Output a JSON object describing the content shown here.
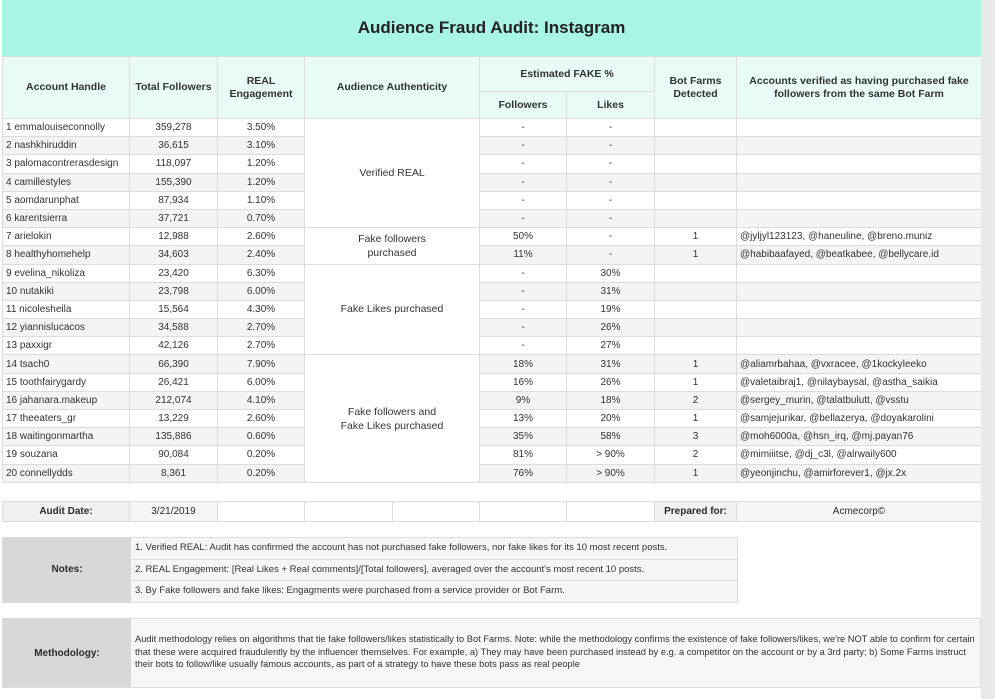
{
  "title": "Audience Fraud Audit: Instagram",
  "headers": {
    "account_handle": "Account Handle",
    "total_followers": "Total Followers",
    "real_engagement": "REAL Engagement",
    "audience_authenticity": "Audience Authenticity",
    "estimated_fake": "Estimated FAKE %",
    "fake_followers": "Followers",
    "fake_likes": "Likes",
    "bot_farms": "Bot Farms Detected",
    "same_farm_accounts": "Accounts verified as having purchased fake followers from the same Bot Farm"
  },
  "groups": {
    "verified_real": "Verified REAL",
    "fake_followers": "Fake followers purchased",
    "fake_likes": "Fake Likes purchased",
    "fake_both": "Fake followers and Fake Likes purchased"
  },
  "rows": [
    {
      "handle": "1 emmalouiseconnolly",
      "followers": "359,278",
      "engagement": "3.50%",
      "fake_followers": "-",
      "fake_likes": "-",
      "bot_farms": "",
      "accounts": ""
    },
    {
      "handle": "2 nashkhiruddin",
      "followers": "36,615",
      "engagement": "3.10%",
      "fake_followers": "-",
      "fake_likes": "-",
      "bot_farms": "",
      "accounts": ""
    },
    {
      "handle": "3 palomacontrerasdesign",
      "followers": "118,097",
      "engagement": "1.20%",
      "fake_followers": "-",
      "fake_likes": "-",
      "bot_farms": "",
      "accounts": ""
    },
    {
      "handle": "4 camillestyles",
      "followers": "155,390",
      "engagement": "1.20%",
      "fake_followers": "-",
      "fake_likes": "-",
      "bot_farms": "",
      "accounts": ""
    },
    {
      "handle": "5 aomdarunphat",
      "followers": "87,934",
      "engagement": "1.10%",
      "fake_followers": "-",
      "fake_likes": "-",
      "bot_farms": "",
      "accounts": ""
    },
    {
      "handle": "6 karentsierra",
      "followers": "37,721",
      "engagement": "0.70%",
      "fake_followers": "-",
      "fake_likes": "-",
      "bot_farms": "",
      "accounts": ""
    },
    {
      "handle": "7 arielokin",
      "followers": "12,988",
      "engagement": "2.60%",
      "fake_followers": "50%",
      "fake_likes": "-",
      "bot_farms": "1",
      "accounts": "@jyljyl123123, @haneuline, @breno.muniz"
    },
    {
      "handle": "8 healthyhomehelp",
      "followers": "34,603",
      "engagement": "2.40%",
      "fake_followers": "11%",
      "fake_likes": "-",
      "bot_farms": "1",
      "accounts": "@habibaafayed, @beatkabee, @bellycare.id"
    },
    {
      "handle": "9 evelina_nikoliza",
      "followers": "23,420",
      "engagement": "6.30%",
      "fake_followers": "-",
      "fake_likes": "30%",
      "bot_farms": "",
      "accounts": ""
    },
    {
      "handle": "10 nutakiki",
      "followers": "23,798",
      "engagement": "6.00%",
      "fake_followers": "-",
      "fake_likes": "31%",
      "bot_farms": "",
      "accounts": ""
    },
    {
      "handle": "11 nicolesheila",
      "followers": "15,564",
      "engagement": "4.30%",
      "fake_followers": "-",
      "fake_likes": "19%",
      "bot_farms": "",
      "accounts": ""
    },
    {
      "handle": "12 yiannislucacos",
      "followers": "34,588",
      "engagement": "2.70%",
      "fake_followers": "-",
      "fake_likes": "26%",
      "bot_farms": "",
      "accounts": ""
    },
    {
      "handle": "13 paxxigr",
      "followers": "42,126",
      "engagement": "2.70%",
      "fake_followers": "-",
      "fake_likes": "27%",
      "bot_farms": "",
      "accounts": ""
    },
    {
      "handle": "14 tsach0",
      "followers": "66,390",
      "engagement": "7.90%",
      "fake_followers": "18%",
      "fake_likes": "31%",
      "bot_farms": "1",
      "accounts": "@aliamrbahaa, @vxracee, @1kockyleeko"
    },
    {
      "handle": "15 toothfairygardy",
      "followers": "26,421",
      "engagement": "6.00%",
      "fake_followers": "16%",
      "fake_likes": "26%",
      "bot_farms": "1",
      "accounts": "@valetaibraj1, @nilaybaysal, @astha_saikia"
    },
    {
      "handle": "16 jahanara.makeup",
      "followers": "212,074",
      "engagement": "4.10%",
      "fake_followers": "9%",
      "fake_likes": "18%",
      "bot_farms": "2",
      "accounts": "@sergey_murin, @talatbulutt, @vsstu"
    },
    {
      "handle": "17 theeaters_gr",
      "followers": "13,229",
      "engagement": "2.60%",
      "fake_followers": "13%",
      "fake_likes": "20%",
      "bot_farms": "1",
      "accounts": "@samjejurikar, @bellazerya, @doyakarolini"
    },
    {
      "handle": "18 waitingonmartha",
      "followers": "135,886",
      "engagement": "0.60%",
      "fake_followers": "35%",
      "fake_likes": "58%",
      "bot_farms": "3",
      "accounts": "@moh6000a, @hsn_irq, @mj.payan76"
    },
    {
      "handle": "19 souzana",
      "followers": "90,084",
      "engagement": "0.20%",
      "fake_followers": "81%",
      "fake_likes": "> 90%",
      "bot_farms": "2",
      "accounts": "@mimiiitse, @dj_c3l, @alrwaily600"
    },
    {
      "handle": "20 connellydds",
      "followers": "8,361",
      "engagement": "0.20%",
      "fake_followers": "76%",
      "fake_likes": "> 90%",
      "bot_farms": "1",
      "accounts": "@yeonjinchu, @amirforever1, @jx.2x"
    }
  ],
  "audit": {
    "date_label": "Audit Date:",
    "date_value": "3/21/2019",
    "prepared_label": "Prepared for:",
    "prepared_value": "Acmecorp©"
  },
  "notes": {
    "label": "Notes:",
    "lines": [
      "1. Verified REAL: Audit has confirmed the account has not purchased fake followers, nor fake likes for its 10 most recent posts.",
      "2. REAL Engagement: [Real Likes + Real comments]/[Total followers], averaged over the account's most recent 10 posts.",
      "3. By Fake followers and fake likes: Engagments were purchased from a service provider or Bot Farm."
    ]
  },
  "methodology": {
    "label": "Methodology:",
    "text": "Audit methodology relies on algorithms that tie fake followers/likes statistically to Bot Farms. Note: while the methodology confirms the existence of fake followers/likes, we're NOT able to confirm for certain that these were acquired fraudulently by the influencer themselves. For example, a) They may have been purchased instead by e.g. a competitor on the account or by a 3rd party; b) Some Farms instruct their bots to follow/like usually famous accounts, as part of a strategy to have these bots pass as real people"
  },
  "colors": {
    "title_bg": "#a8f5e6",
    "header_bg": "#e9fbf7",
    "label_bg": "#d8d8d8"
  }
}
